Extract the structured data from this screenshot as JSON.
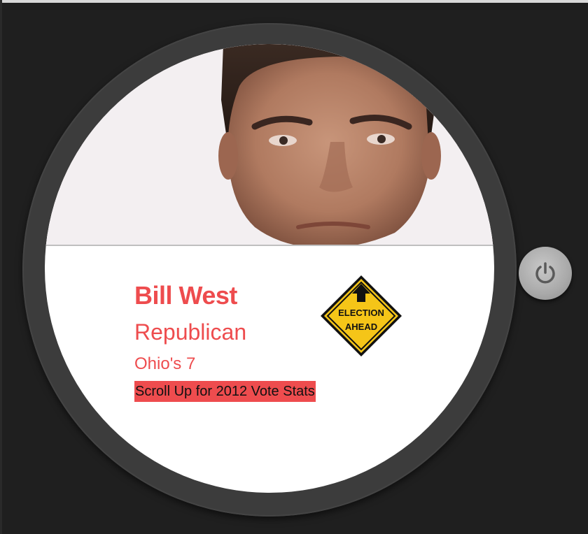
{
  "candidate": {
    "name": "Bill West",
    "party": "Republican",
    "district": "Ohio's 7"
  },
  "hint": {
    "text": "Scroll Up for 2012 Vote Stats"
  },
  "sign": {
    "line1": "ELECTION",
    "line2": "AHEAD",
    "color": "#f5c518"
  },
  "colors": {
    "accent": "#ee4c4e",
    "background": "#1f1f1f"
  },
  "icons": {
    "power": "power-icon",
    "sign": "election-ahead-sign-icon"
  }
}
